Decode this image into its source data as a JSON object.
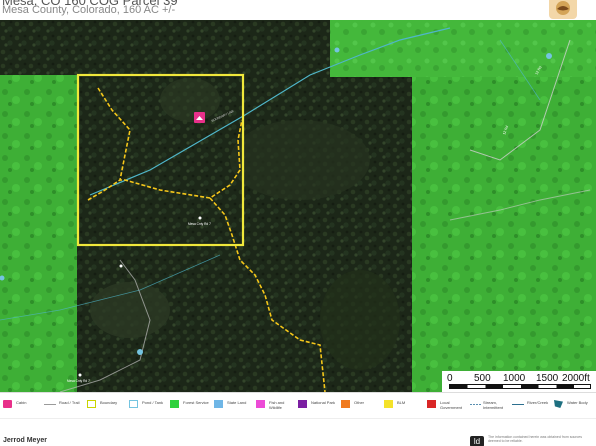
{
  "header": {
    "title": "Mesa, CO 160 COG Parcel 39",
    "subtitle": "Mesa County, Colorado, 160 AC +/-"
  },
  "map": {
    "cabin_icon": "cabin-icon",
    "parcel_label": "Mesa Cnty Rd 7",
    "road_label_diag": "BOUNDARY LINE",
    "road_label_right_1": "12 Rd",
    "road_label_right_2": "12 Rd",
    "road_label_bottom": "Mesa Cnty Rd 7",
    "colors": {
      "private": "#1f2a1c",
      "blm_green": "#41b93a",
      "parcel_outline": "#f0e83b",
      "trail": "#f5c71a",
      "stream": "#4fb6c9"
    }
  },
  "scale": {
    "ticks": [
      "0",
      "500",
      "1000",
      "1500",
      "2000ft"
    ]
  },
  "legend": {
    "items": [
      {
        "label": "Cabin",
        "color": "#e8308a"
      },
      {
        "label": "Road / Trail",
        "color": "#9a9a9a"
      },
      {
        "label": "Boundary",
        "color": "#c9d400"
      },
      {
        "label": "Pond / Tank",
        "color": "#74c4e0"
      },
      {
        "label": "Forest Service",
        "color": "#2fd13d"
      },
      {
        "label": "State Land",
        "color": "#6fb6e6"
      },
      {
        "label": "Fish and Wildlife",
        "color": "#ec4bd6"
      },
      {
        "label": "National Park",
        "color": "#7b1fa2"
      },
      {
        "label": "Other",
        "color": "#f07a1e"
      },
      {
        "label": "BLM",
        "color": "#f4e22a"
      },
      {
        "label": "Local Government",
        "color": "#d92626"
      },
      {
        "label": "Stream, Intermittent",
        "color": "#5a8fb0"
      },
      {
        "label": "River/Creek",
        "color": "#2c6f8f"
      },
      {
        "label": "Water Body",
        "color": "#1d6f80"
      }
    ]
  },
  "footer": {
    "agent": "Jerrod Meyer",
    "icon_text": "ld",
    "disclaimer": "The information contained herein was obtained from sources deemed to be reliable."
  }
}
